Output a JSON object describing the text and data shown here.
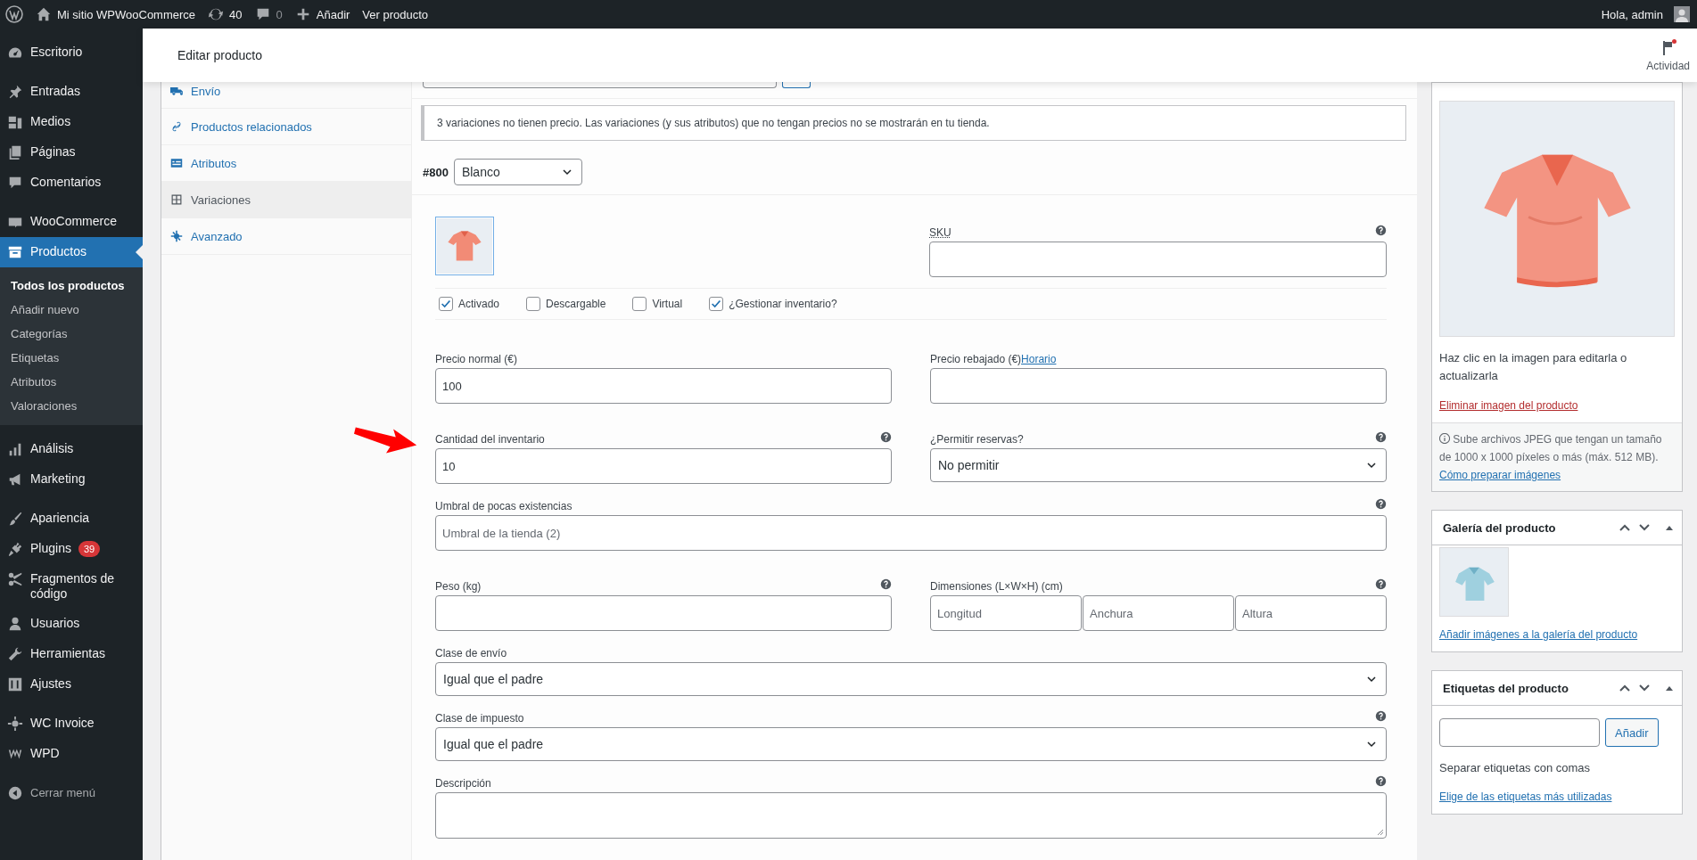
{
  "admin_bar": {
    "site_name": "Mi sitio WPWooCommerce",
    "updates_count": "40",
    "comments_count": "0",
    "new_label": "Añadir",
    "view_label": "Ver producto",
    "greeting": "Hola, admin"
  },
  "sidebar": {
    "groups": [
      [
        {
          "label": "Escritorio",
          "selected": false
        }
      ],
      [
        {
          "label": "Entradas",
          "selected": false
        },
        {
          "label": "Medios",
          "selected": false
        },
        {
          "label": "Páginas",
          "selected": false
        },
        {
          "label": "Comentarios",
          "selected": false
        }
      ],
      [
        {
          "label": "WooCommerce",
          "selected": false
        },
        {
          "label": "Productos",
          "selected": true,
          "children": [
            {
              "label": "Todos los productos",
              "selected": true
            },
            {
              "label": "Añadir nuevo",
              "selected": false
            },
            {
              "label": "Categorías",
              "selected": false
            },
            {
              "label": "Etiquetas",
              "selected": false
            },
            {
              "label": "Atributos",
              "selected": false
            },
            {
              "label": "Valoraciones",
              "selected": false
            }
          ]
        }
      ],
      [
        {
          "label": "Análisis",
          "selected": false
        },
        {
          "label": "Marketing",
          "selected": false
        }
      ],
      [
        {
          "label": "Apariencia",
          "selected": false
        },
        {
          "label": "Plugins",
          "selected": false,
          "badge": "39"
        },
        {
          "label": "Fragmentos de código",
          "selected": false
        },
        {
          "label": "Usuarios",
          "selected": false
        },
        {
          "label": "Herramientas",
          "selected": false
        },
        {
          "label": "Ajustes",
          "selected": false
        }
      ],
      [
        {
          "label": "WC Invoice",
          "selected": false
        },
        {
          "label": "WPD",
          "selected": false
        }
      ]
    ],
    "collapse_label": "Cerrar menú"
  },
  "header": {
    "title": "Editar producto",
    "activity_label": "Actividad",
    "activity_unread": true
  },
  "product_tabs": [
    {
      "label": "Envío",
      "selected": false
    },
    {
      "label": "Productos relacionados",
      "selected": false
    },
    {
      "label": "Atributos",
      "selected": false
    },
    {
      "label": "Variaciones",
      "selected": true
    },
    {
      "label": "Avanzado",
      "selected": false
    }
  ],
  "notice": "3 variaciones no tienen precio. Las variaciones (y sus atributos) que no tengan precios no se mostrarán en tu tienda.",
  "variation": {
    "id": "#800",
    "attribute": "Blanco",
    "sku": {
      "label": "SKU",
      "abbreviation": true,
      "help": true
    },
    "options": [
      {
        "label": "Activado",
        "checked": true
      },
      {
        "label": "Descargable",
        "checked": false
      },
      {
        "label": "Virtual",
        "checked": false
      },
      {
        "label": "¿Gestionar inventario?",
        "checked": true
      }
    ],
    "rows": [
      [
        {
          "kind": "input",
          "label": "Precio normal (€)",
          "help": false,
          "value": "100"
        },
        {
          "kind": "input",
          "label": "Precio rebajado (€)",
          "label_link": "Horario",
          "help": false
        }
      ],
      [
        {
          "kind": "input",
          "label": "Cantidad del inventario",
          "help": true,
          "value": "10"
        },
        {
          "kind": "select",
          "label": "¿Permitir reservas?",
          "help": true,
          "value": "No permitir"
        }
      ],
      [
        {
          "kind": "input",
          "label": "Umbral de pocas existencias",
          "help": true,
          "placeholder": "Umbral de la tienda (2)"
        }
      ],
      [
        {
          "kind": "input",
          "label": "Peso (kg)",
          "help": true
        },
        {
          "kind": "dimensions",
          "label": "Dimensiones (L×W×H) (cm)",
          "help": true,
          "placeholders": [
            "Longitud",
            "Anchura",
            "Altura"
          ]
        }
      ],
      [
        {
          "kind": "select",
          "label": "Clase de envío",
          "help": false,
          "value": "Igual que el padre"
        }
      ],
      [
        {
          "kind": "select",
          "label": "Clase de impuesto",
          "help": true,
          "value": "Igual que el padre"
        }
      ],
      [
        {
          "kind": "textarea",
          "label": "Descripción",
          "help": true
        }
      ]
    ]
  },
  "product_image": {
    "hint": "Haz clic en la imagen para editarla o actualizarla",
    "remove_link": "Eliminar imagen del producto",
    "note": "Sube archivos JPEG que tengan un tamaño de 1000 x 1000 píxeles o más (máx. 512 MB).",
    "note_link": "Cómo preparar imágenes"
  },
  "gallery": {
    "title": "Galería del producto",
    "add_link": "Añadir imágenes a la galería del producto"
  },
  "tags": {
    "title": "Etiquetas del producto",
    "button": "Añadir",
    "note": "Separar etiquetas con comas",
    "link": "Elige de las etiquetas más utilizadas"
  }
}
